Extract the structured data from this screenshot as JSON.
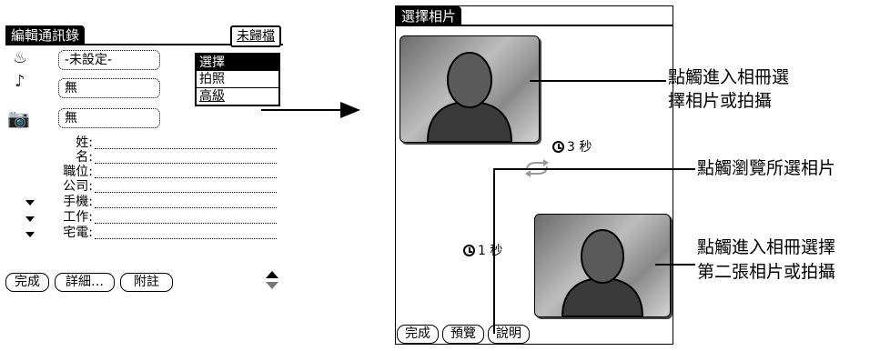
{
  "left_screen": {
    "title": "編輯通訊錄",
    "category": "未歸檔",
    "rows": [
      {
        "icon": "cake-icon",
        "value": "-未設定-"
      },
      {
        "icon": "music-note-icon",
        "value": "無"
      },
      {
        "icon": "camera-icon",
        "value": "無"
      }
    ],
    "menu_items": [
      "選擇",
      "拍照",
      "高級"
    ],
    "fields": [
      "姓:",
      "名:",
      "職位:",
      "公司:",
      "手機:",
      "工作:",
      "宅電:"
    ],
    "buttons": [
      "完成",
      "詳細…",
      "附註"
    ]
  },
  "right_screen": {
    "title": "選擇相片",
    "timer1": "3 秒",
    "timer2": "1 秒",
    "buttons": [
      "完成",
      "預覽",
      "說明"
    ]
  },
  "annotations": {
    "a1_line1": "點觸進入相冊選",
    "a1_line2": "擇相片或拍攝",
    "a2": "點觸瀏覽所選相片",
    "a3_line1": "點觸進入相冊選擇",
    "a3_line2": "第二張相片或拍攝"
  }
}
